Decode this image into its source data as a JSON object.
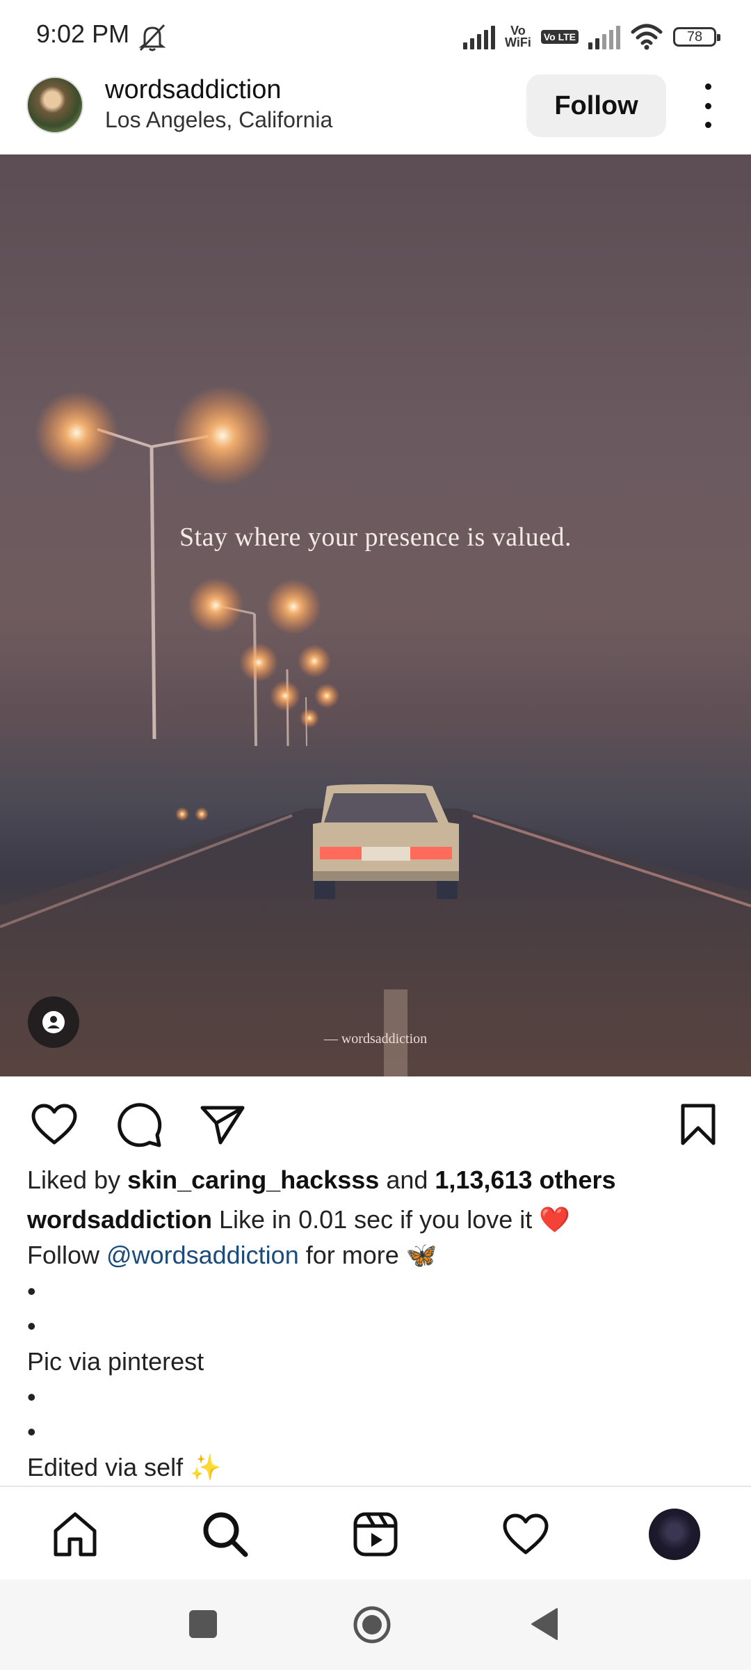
{
  "status_bar": {
    "time": "9:02 PM",
    "vowifi_line1": "Vo",
    "vowifi_line2": "WiFi",
    "lte": "Vo LTE",
    "battery": "78"
  },
  "post": {
    "username": "wordsaddiction",
    "location": "Los Angeles, California",
    "follow_label": "Follow",
    "image_quote": "Stay where your presence is valued.",
    "image_credit": "— wordsaddiction"
  },
  "likes": {
    "prefix": "Liked by ",
    "user": "skin_caring_hacksss",
    "middle": " and ",
    "others": "1,13,613 others"
  },
  "caption": {
    "username": "wordsaddiction",
    "line1": " Like in 0.01 sec if you love it ❤️",
    "line2_prefix": "Follow ",
    "mention": "@wordsaddiction",
    "line2_suffix": " for more 🦋",
    "dot": "•",
    "line3": "Pic via pinterest",
    "line4": "Edited via self ✨"
  },
  "icons": {
    "like": "heart-icon",
    "comment": "comment-icon",
    "share": "send-icon",
    "save": "bookmark-icon",
    "home": "home-icon",
    "search": "search-icon",
    "reels": "reels-icon",
    "activity": "heart-icon",
    "profile": "profile-avatar"
  },
  "colors": {
    "mention": "#1a4b7a",
    "follow_bg": "#efefef"
  }
}
